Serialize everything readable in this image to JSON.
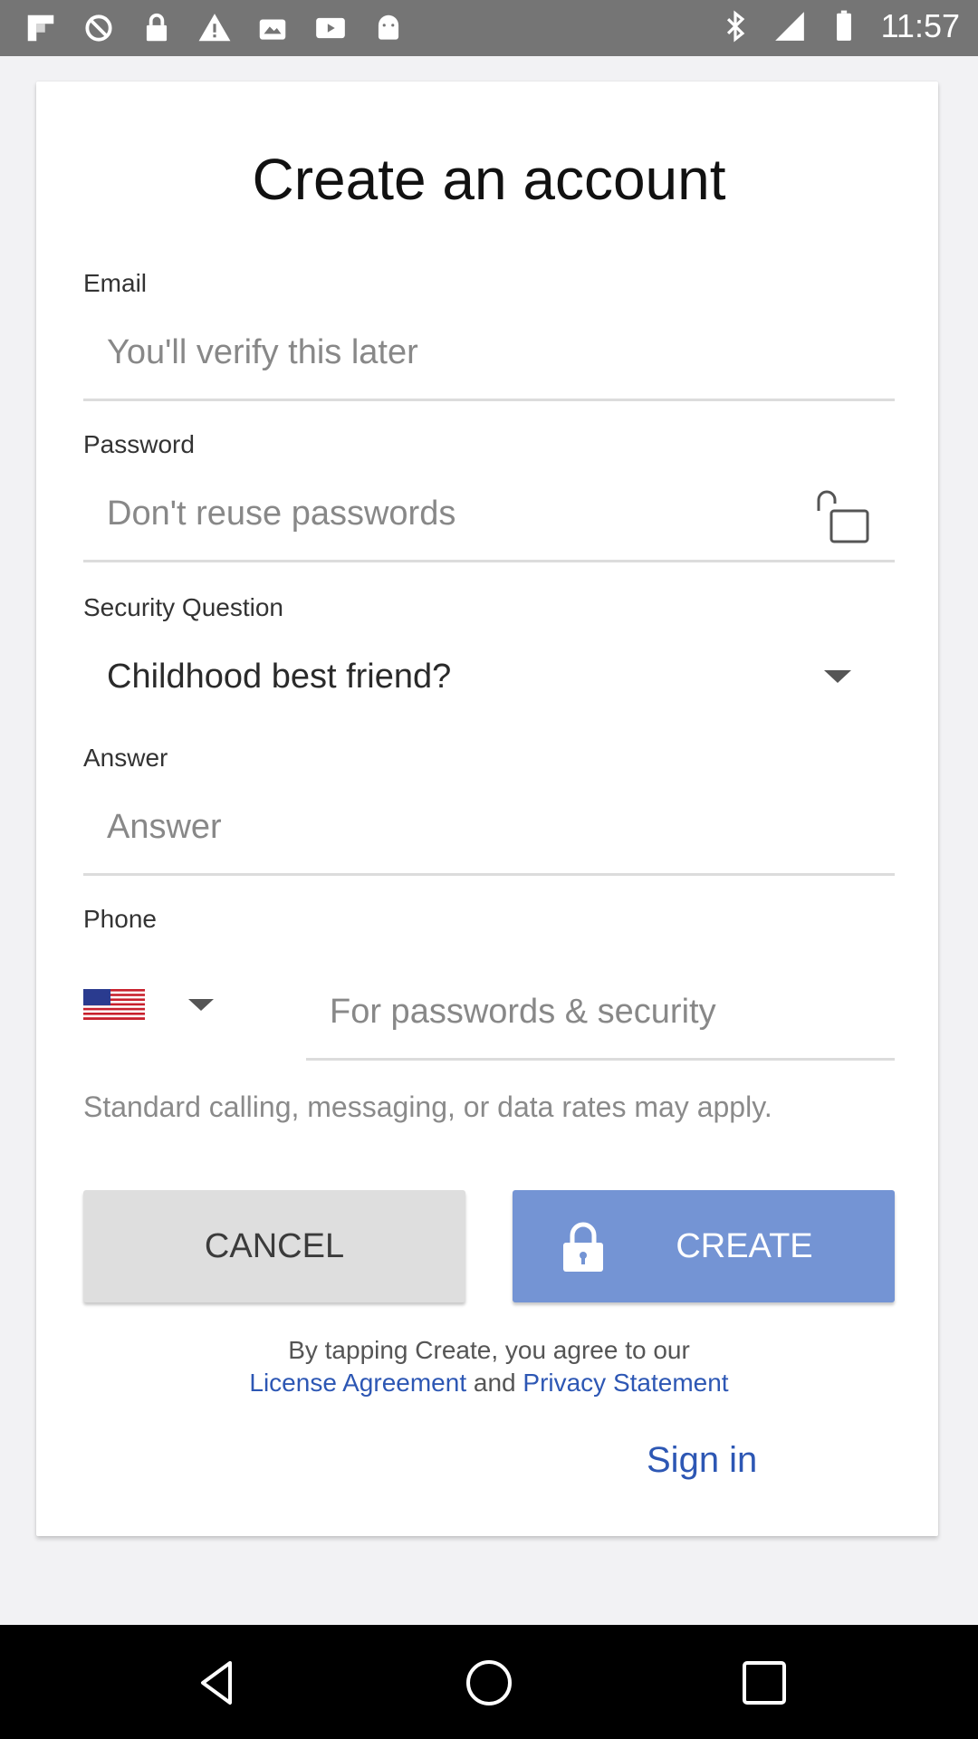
{
  "status_bar": {
    "time": "11:57",
    "left_icons": [
      "flipboard-icon",
      "block-icon",
      "lock-icon",
      "warning-icon",
      "photos-icon",
      "tv-icon",
      "android-icon"
    ],
    "right_icons": [
      "bluetooth-icon",
      "signal-icon",
      "battery-icon"
    ]
  },
  "form": {
    "title": "Create an account",
    "email": {
      "label": "Email",
      "placeholder": "You'll verify this later"
    },
    "password": {
      "label": "Password",
      "placeholder": "Don't reuse passwords"
    },
    "security_question": {
      "label": "Security Question",
      "value": "Childhood best friend?"
    },
    "answer": {
      "label": "Answer",
      "placeholder": "Answer"
    },
    "phone": {
      "label": "Phone",
      "country": "US",
      "placeholder": "For passwords & security"
    },
    "rates_note": "Standard calling, messaging, or data rates may apply.",
    "cancel_label": "CANCEL",
    "create_label": "CREATE",
    "terms_line1": "By tapping Create, you agree to our",
    "license_link": "License Agreement",
    "and_text": "and",
    "privacy_link": "Privacy Statement",
    "sign_in": "Sign in"
  },
  "colors": {
    "primary_button": "#7494d4",
    "link": "#2d57b4",
    "status_bar": "#757575"
  },
  "nav_bar": {
    "icons": [
      "back-icon",
      "home-icon",
      "recents-icon"
    ]
  }
}
